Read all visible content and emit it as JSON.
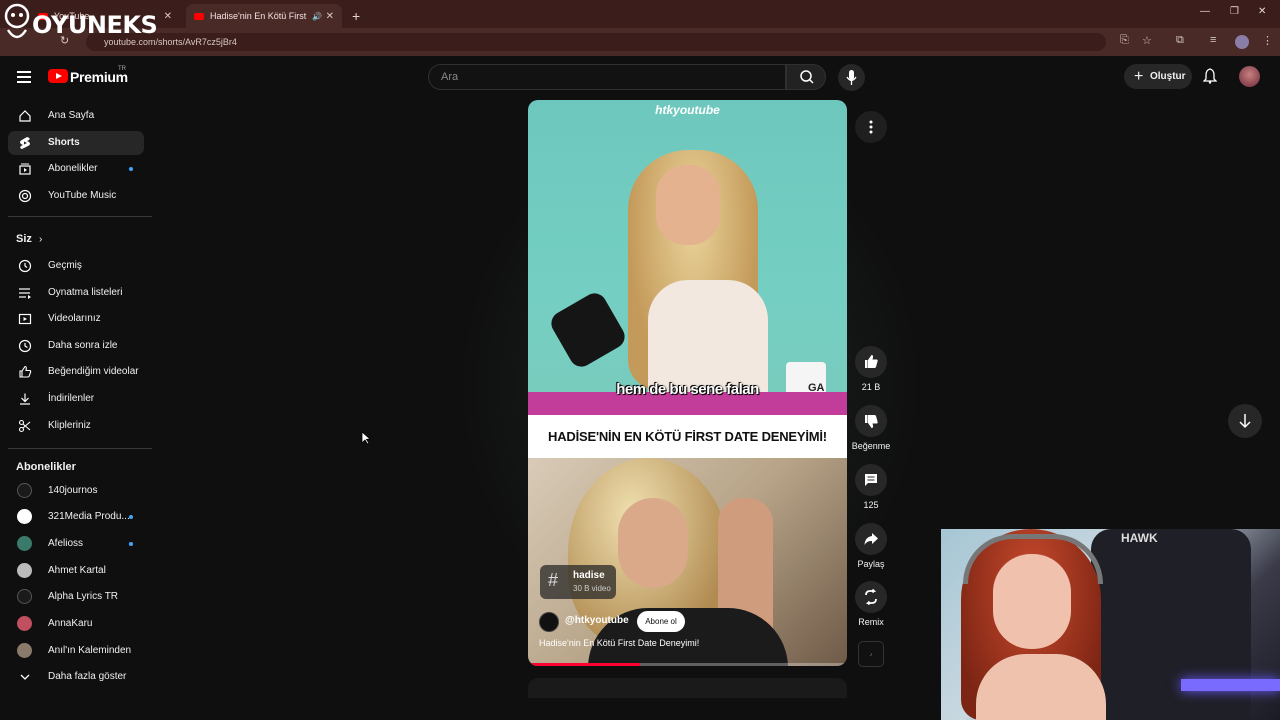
{
  "browser": {
    "tabs": [
      {
        "label": "YouTube",
        "active": false
      },
      {
        "label": "Hadise'nin En Kötü First Da",
        "active": true
      }
    ],
    "url": "youtube.com/shorts/AvR7cz5jBr4"
  },
  "watermark": {
    "text": "OYUNEKS"
  },
  "header": {
    "brand": "Premium",
    "country": "TR",
    "search_placeholder": "Ara",
    "create_label": "Oluştur"
  },
  "sidebar": {
    "main": [
      {
        "label": "Ana Sayfa",
        "icon": "home-icon"
      },
      {
        "label": "Shorts",
        "icon": "shorts-icon",
        "active": true
      },
      {
        "label": "Abonelikler",
        "icon": "subscriptions-icon",
        "dot": true
      },
      {
        "label": "YouTube Music",
        "icon": "music-icon"
      }
    ],
    "you_header": "Siz",
    "you": [
      {
        "label": "Geçmiş",
        "icon": "history-icon"
      },
      {
        "label": "Oynatma listeleri",
        "icon": "playlist-icon"
      },
      {
        "label": "Videolarınız",
        "icon": "your-videos-icon"
      },
      {
        "label": "Daha sonra izle",
        "icon": "watch-later-icon"
      },
      {
        "label": "Beğendiğim videolar",
        "icon": "liked-icon"
      },
      {
        "label": "İndirilenler",
        "icon": "download-icon"
      },
      {
        "label": "Klipleriniz",
        "icon": "clips-icon"
      }
    ],
    "subs_header": "Abonelikler",
    "subs": [
      {
        "label": "140journos",
        "color": "#1a1a1a",
        "dot": false
      },
      {
        "label": "321Media Produ...",
        "color": "#ffffff",
        "dot": true
      },
      {
        "label": "Afelioss",
        "color": "#3a7a6a",
        "dot": true
      },
      {
        "label": "Ahmet Kartal",
        "color": "#bbbbbb",
        "dot": false
      },
      {
        "label": "Alpha Lyrics TR",
        "color": "#1a1a1a",
        "dot": false
      },
      {
        "label": "AnnaKaru",
        "color": "#c05060",
        "dot": false
      },
      {
        "label": "Anıl'ın Kaleminden",
        "color": "#8a7a6a",
        "dot": false
      }
    ],
    "show_more": "Daha fazla göster"
  },
  "short": {
    "watermark": "htkyoutube",
    "subtitle": "hem de bu sene falan",
    "mug_text": "GA",
    "title_banner": "HADİSE'NİN EN KÖTÜ FİRST DATE DENEYİMİ!",
    "hashtag": {
      "name": "hadise",
      "count": "30 B video"
    },
    "channel": "@htkyoutube",
    "subscribe_label": "Abone ol",
    "video_title": "Hadise'nin En Kötü First Date Deneyimi!",
    "progress": 0.35
  },
  "actions": {
    "like_count": "21 B",
    "dislike_label": "Beğenme",
    "comment_count": "125",
    "share_label": "Paylaş",
    "remix_label": "Remix"
  },
  "webcam": {
    "chair_text": "HAWK"
  },
  "colors": {
    "accent": "#ff0000",
    "active_item": "#272727",
    "dot": "#3ea6ff"
  }
}
